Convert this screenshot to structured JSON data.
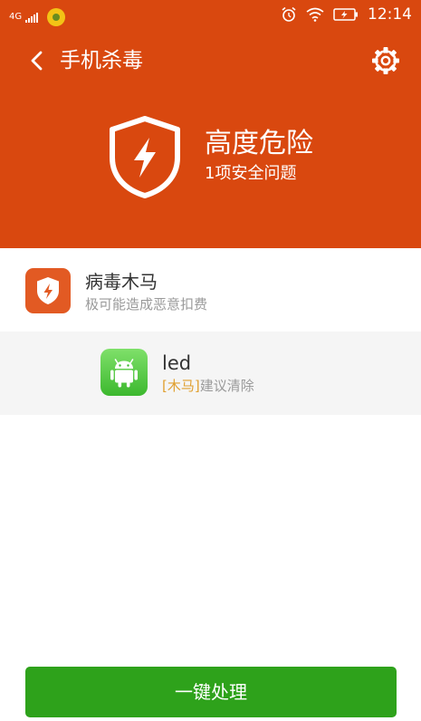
{
  "status_bar": {
    "network": "4G",
    "time": "12:14"
  },
  "toolbar": {
    "title": "手机杀毒"
  },
  "risk": {
    "title": "高度危险",
    "subtitle": "1项安全问题"
  },
  "category": {
    "title": "病毒木马",
    "subtitle": "极可能造成恶意扣费"
  },
  "app_item": {
    "name": "led",
    "tag": "[木马]",
    "advice": "建议清除"
  },
  "action": {
    "label": "一键处理"
  },
  "colors": {
    "header_background": "#D9480F",
    "action_button": "#2EA21B",
    "tag_text": "#E0A030"
  },
  "icons": {
    "back": "back-arrow-icon",
    "settings": "gear-icon",
    "risk": "shield-lightning-icon",
    "category": "shield-lightning-icon",
    "app": "android-icon"
  }
}
